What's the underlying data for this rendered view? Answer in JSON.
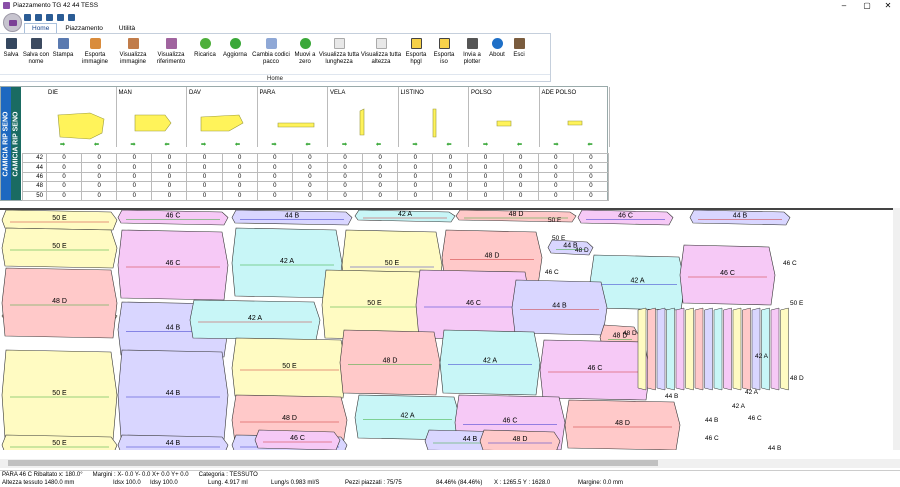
{
  "window": {
    "title": "Piazzamento TG 42 44 TESS",
    "minimize": "–",
    "maximize": "▢",
    "close": "✕"
  },
  "tabs": [
    "Home",
    "Piazzamento",
    "Utilità"
  ],
  "ribbon": {
    "group": "Home",
    "buttons": [
      {
        "label": "Salva",
        "icon": "save-icon"
      },
      {
        "label": "Salva con nome",
        "icon": "save-as-icon"
      },
      {
        "label": "Stampa",
        "icon": "print-icon"
      },
      {
        "label": "Esporta immagine",
        "icon": "export-image-icon"
      },
      {
        "label": "Visualizza immagine",
        "icon": "view-image-icon"
      },
      {
        "label": "Visualizza riferimento",
        "icon": "view-reference-icon"
      },
      {
        "label": "Ricarica",
        "icon": "reload-icon"
      },
      {
        "label": "Aggiorna",
        "icon": "refresh-icon"
      },
      {
        "label": "Cambia codici pacco",
        "icon": "change-codes-icon"
      },
      {
        "label": "Muovi a zero",
        "icon": "move-zero-icon"
      },
      {
        "label": "Visualizza tutta lunghezza",
        "icon": "view-length-icon"
      },
      {
        "label": "Visualizza tutta altezza",
        "icon": "view-height-icon"
      },
      {
        "label": "Esporta hpgl",
        "icon": "hpgl-icon"
      },
      {
        "label": "Esporta iso",
        "icon": "iso-icon"
      },
      {
        "label": "Invia a plotter",
        "icon": "plotter-icon"
      },
      {
        "label": "About",
        "icon": "info-icon"
      },
      {
        "label": "Esci",
        "icon": "exit-icon"
      }
    ]
  },
  "model": {
    "label1": "CAMICIA RIP SENO",
    "label2": "CAMICIA RIP SENO"
  },
  "pieces": [
    "DIE",
    "MAN",
    "DAV",
    "PARA",
    "VELA",
    "LISTINO",
    "POLSO",
    "ADE POLSO"
  ],
  "sizes": [
    {
      "size": "42",
      "q": [
        "0",
        "0",
        "0",
        "0",
        "0",
        "0",
        "0",
        "0",
        "0",
        "0",
        "0",
        "0",
        "0",
        "0",
        "0",
        "0"
      ]
    },
    {
      "size": "44",
      "q": [
        "0",
        "0",
        "0",
        "0",
        "0",
        "0",
        "0",
        "0",
        "0",
        "0",
        "0",
        "0",
        "0",
        "0",
        "0",
        "0"
      ]
    },
    {
      "size": "46",
      "q": [
        "0",
        "0",
        "0",
        "0",
        "0",
        "0",
        "0",
        "0",
        "0",
        "0",
        "0",
        "0",
        "0",
        "0",
        "0",
        "0"
      ]
    },
    {
      "size": "48",
      "q": [
        "0",
        "0",
        "0",
        "0",
        "0",
        "0",
        "0",
        "0",
        "0",
        "0",
        "0",
        "0",
        "0",
        "0",
        "0",
        "0"
      ]
    },
    {
      "size": "50",
      "q": [
        "0",
        "0",
        "0",
        "0",
        "0",
        "0",
        "0",
        "0",
        "0",
        "0",
        "0",
        "0",
        "0",
        "0",
        "0",
        "0"
      ]
    }
  ],
  "marker_labels": [
    {
      "t": "50 E",
      "c": "#fffbc2"
    },
    {
      "t": "46 C",
      "c": "#f6c9f6"
    },
    {
      "t": "44 B",
      "c": "#d9d6ff"
    },
    {
      "t": "42 A",
      "c": "#c8f6f7"
    },
    {
      "t": "48 D",
      "c": "#ffc9c9"
    },
    {
      "t": "46 C",
      "c": "#f6c9f6"
    },
    {
      "t": "44 B",
      "c": "#d9d6ff"
    },
    {
      "t": "50 E",
      "c": "#fffbc2"
    },
    {
      "t": "50 E",
      "c": "#fffbc2"
    },
    {
      "t": "46 C",
      "c": "#f6c9f6"
    },
    {
      "t": "42 A",
      "c": "#c8f6f7"
    },
    {
      "t": "50 E",
      "c": "#fffbc2"
    },
    {
      "t": "48 D",
      "c": "#ffc9c9"
    },
    {
      "t": "44 B",
      "c": "#d9d6ff"
    },
    {
      "t": "42 A",
      "c": "#c8f6f7"
    },
    {
      "t": "46 C",
      "c": "#f6c9f6"
    },
    {
      "t": "48 D",
      "c": "#ffc9c9"
    },
    {
      "t": "44 B",
      "c": "#d9d6ff"
    },
    {
      "t": "42 A",
      "c": "#c8f6f7"
    },
    {
      "t": "50 E",
      "c": "#fffbc2"
    },
    {
      "t": "46 C",
      "c": "#f6c9f6"
    },
    {
      "t": "44 B",
      "c": "#d9d6ff"
    },
    {
      "t": "48 D",
      "c": "#ffc9c9"
    },
    {
      "t": "44 B",
      "c": "#d9d6ff"
    },
    {
      "t": "50 E",
      "c": "#fffbc2"
    },
    {
      "t": "48 D",
      "c": "#ffc9c9"
    },
    {
      "t": "42 A",
      "c": "#c8f6f7"
    },
    {
      "t": "46 C",
      "c": "#f6c9f6"
    },
    {
      "t": "50 E",
      "c": "#fffbc2"
    },
    {
      "t": "44 B",
      "c": "#d9d6ff"
    },
    {
      "t": "48 D",
      "c": "#ffc9c9"
    },
    {
      "t": "42 A",
      "c": "#c8f6f7"
    },
    {
      "t": "46 C",
      "c": "#f6c9f6"
    },
    {
      "t": "48 D",
      "c": "#ffc9c9"
    },
    {
      "t": "50 E",
      "c": "#fffbc2"
    },
    {
      "t": "44 B",
      "c": "#d9d6ff"
    },
    {
      "t": "46 C",
      "c": "#f6c9f6"
    },
    {
      "t": "44 B",
      "c": "#d9d6ff"
    },
    {
      "t": "48 D",
      "c": "#ffc9c9"
    }
  ],
  "small_labels": [
    "50 E",
    "50 E",
    "48 D",
    "46 C",
    "48 D",
    "44 B",
    "44 B",
    "46 C",
    "42 A",
    "42 A",
    "48 D",
    "46 C",
    "44 B",
    "42 A",
    "50 E",
    "46 C"
  ],
  "status": {
    "line1": [
      "PARA 46 C  Ribaltato x: 180.0°",
      "Margini :  X- 0.0  Y- 0.0  X+ 0.0  Y+ 0.0",
      "Categoria :  TESSUTO"
    ],
    "altezza": "Altezza tessuto 1480.0 mm",
    "idsx": "Idsx 100.0",
    "idsy": "Idsy 100.0",
    "lung": "Lung. 4.917 ml",
    "lungs": "Lung/s 0.983 ml/S",
    "pezzi": "Pezzi piazzati : 75/75",
    "perc": "84.46% (84.46%)",
    "xy": "X : 1265.5   Y : 1628.0",
    "margine": "Margine: 0.0 mm"
  }
}
